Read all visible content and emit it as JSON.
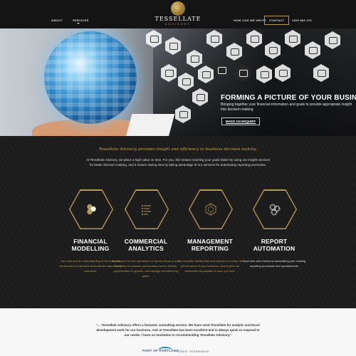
{
  "nav": {
    "about": "ABOUT",
    "services": "SERVICES",
    "help": "HOW CAN WE HELP?",
    "contact": "CONTACT",
    "phone": "1300 883 376"
  },
  "brand": {
    "name": "TESSELLATE",
    "sub": "ADVISORY",
    "accent": "#b59a5a"
  },
  "hero": {
    "title": "FORMING A PICTURE OF YOUR BUSINESS",
    "text": "Bringing together your financial information and goals to provide appropriate insight into decision-making",
    "button": "MAKE AN ENQUIRY",
    "slides": 2,
    "active_slide": 1
  },
  "intro": {
    "tagline": "Tessellate Advisory provides insight and efficiency to business decision making.",
    "text": "At Tessellate Advisory, we place a high value on time. For you, this means reaching your goals faster by using our insight services for better decision-making, and it means saving time by taking advantage of our services for automating reporting processes."
  },
  "features": [
    {
      "title_l1": "FINANCIAL",
      "title_l2": "MODELLING",
      "icon": "gold-hexagons-icon",
      "text": "Use data and an understanding of the business environment to simulate financial and operational scenarios."
    },
    {
      "title_l1": "COMMERCIAL",
      "title_l2": "ANALYTICS",
      "icon": "list-icon",
      "text": "Dig deeper into the operations of various areas of your business to measure performance and to identify opportunities for growth, cost savings and efficiency gains."
    },
    {
      "title_l1": "MANAGEMENT",
      "title_l2": "REPORTING",
      "icon": "hexagon-outline-icon",
      "text": "Use beautiful dashboards and reports to monitor the performance of your business, having them as automated as possible to save you time."
    },
    {
      "title_l1": "REPORT",
      "title_l2": "AUTOMATION",
      "icon": "gears-icon",
      "text": "Save time and money by automating your existing reporting processes and spreadsheets"
    }
  ],
  "testimonial": {
    "quote": "\"... Tessellate Advisory offers a fantastic consulting service. We have used Tessellate for analytic and Excel development work for our business. Ash at Tessellate has been excellent and is always quick to respond to our needs. I have no hesitation in recommending Tessellate Advisory.\"",
    "company": "PORT OF PORTLAND",
    "person": "GREG TREWEWEN"
  }
}
